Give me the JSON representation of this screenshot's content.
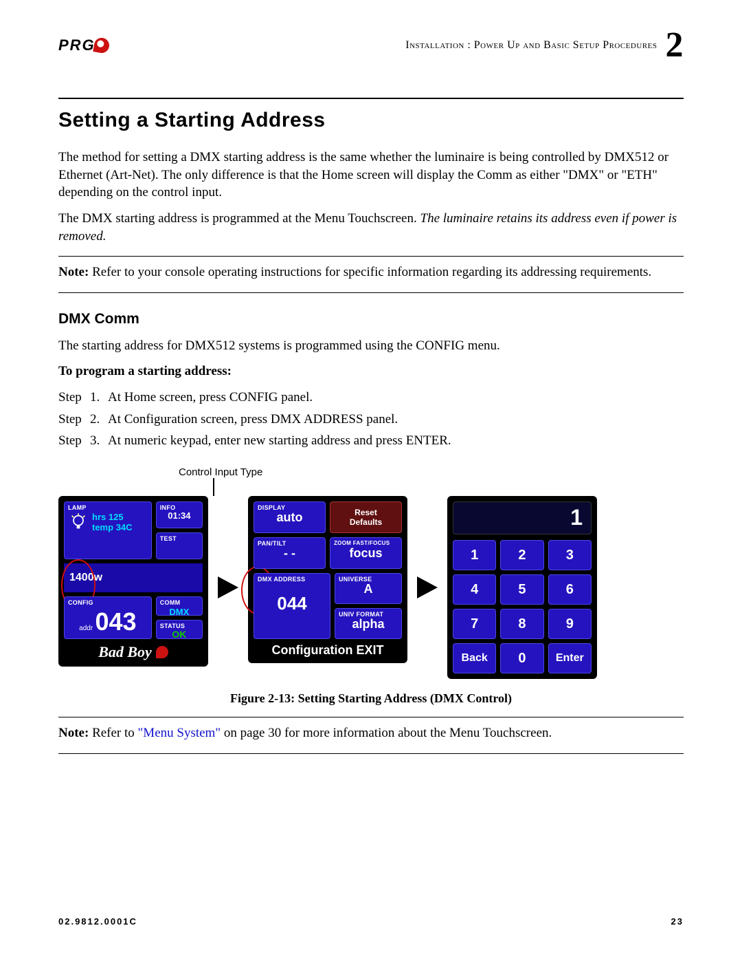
{
  "header": {
    "logo_text": "PRG",
    "breadcrumb": "Installation : Power Up and Basic Setup Procedures",
    "chapter_number": "2"
  },
  "h1": "Setting a Starting Address",
  "para1": "The method for setting a DMX starting address is the same whether the luminaire is being controlled by DMX512 or Ethernet (Art-Net). The only difference is that the Home screen will display the Comm as either \"DMX\" or \"ETH\" depending on the control input.",
  "para2a": "The DMX starting address is programmed at the Menu Touchscreen. ",
  "para2b_italic": "The luminaire retains its address even if power is removed.",
  "note1_label": "Note:",
  "note1_text": "  Refer to your console operating instructions for specific information regarding its addressing requirements.",
  "h2": "DMX Comm",
  "para3": "The starting address for DMX512 systems is programmed using the CONFIG menu.",
  "to_program": "To program a starting address:",
  "steps": [
    {
      "lbl": "Step",
      "num": "1.",
      "text": "At Home screen, press CONFIG panel."
    },
    {
      "lbl": "Step",
      "num": "2.",
      "text": "At Configuration screen, press DMX ADDRESS panel."
    },
    {
      "lbl": "Step",
      "num": "3.",
      "text": "At numeric keypad, enter new starting address and press ENTER."
    }
  ],
  "callout": "Control Input Type",
  "panel1": {
    "lamp_label": "LAMP",
    "hrs_label": "hrs",
    "hrs_val": "125",
    "temp_label": "temp",
    "temp_val": "34C",
    "info_label": "INFO",
    "info_val": "01:34",
    "test_label": "TEST",
    "mid": "1400w",
    "config_label": "CONFIG",
    "addr_label": "addr",
    "addr_val": "043",
    "comm_label": "COMM",
    "comm_val": "DMX",
    "status_label": "STATUS",
    "status_val": "OK",
    "brand": "Bad Boy"
  },
  "panel2": {
    "display_label": "DISPLAY",
    "display_val": "auto",
    "reset_line1": "Reset",
    "reset_line2": "Defaults",
    "pt_label": "PAN/TILT",
    "pt_val": "- -",
    "zoom_label": "ZOOM FAST/FOCUS",
    "zoom_val": "focus",
    "dmx_label": "DMX ADDRESS",
    "dmx_val": "044",
    "univ_label": "UNIVERSE",
    "univ_val": "A",
    "fmt_label": "UNIV FORMAT",
    "fmt_val": "alpha",
    "footer": "Configuration EXIT"
  },
  "panel3": {
    "display": "1",
    "keys": [
      "1",
      "2",
      "3",
      "4",
      "5",
      "6",
      "7",
      "8",
      "9",
      "Back",
      "0",
      "Enter"
    ]
  },
  "fig_caption": "Figure 2-13:  Setting Starting Address (DMX Control)",
  "note2_label": "Note:",
  "note2_pre": "  Refer to ",
  "note2_link": "\"Menu System\"",
  "note2_post": " on page 30 for more information about the Menu Touchscreen.",
  "footer": {
    "docnum": "02.9812.0001C",
    "page": "23"
  }
}
